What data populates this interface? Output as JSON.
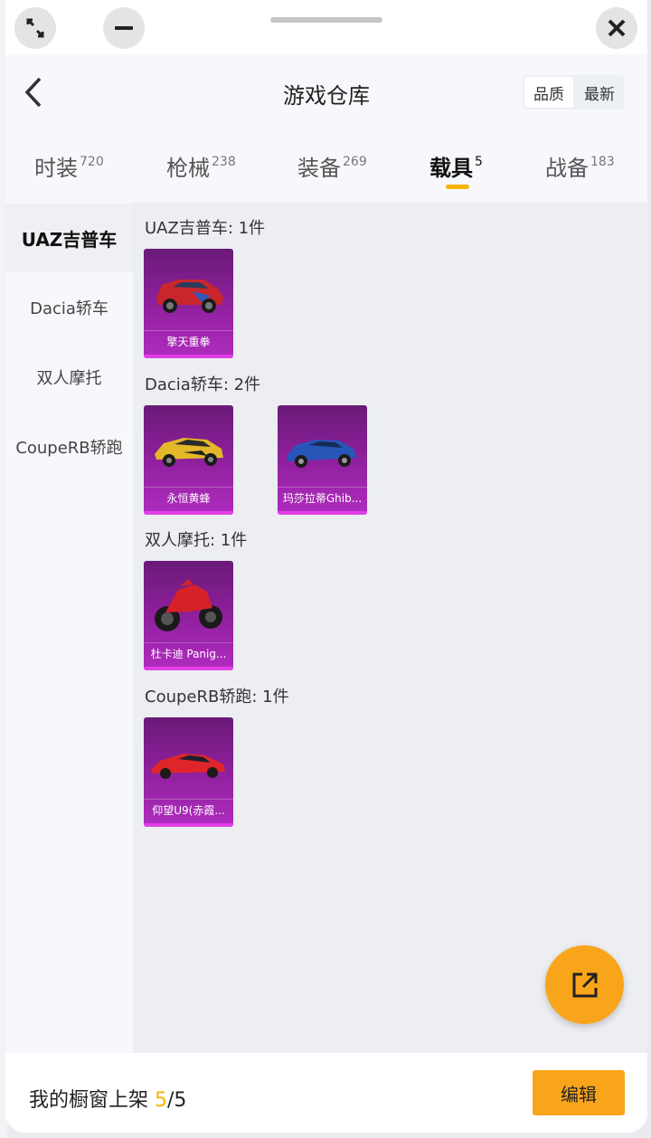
{
  "header": {
    "title": "游戏仓库",
    "sort_options": [
      "品质",
      "最新"
    ],
    "sort_active": "品质"
  },
  "tabs": [
    {
      "label": "时装",
      "count": "720"
    },
    {
      "label": "枪械",
      "count": "238"
    },
    {
      "label": "装备",
      "count": "269"
    },
    {
      "label": "载具",
      "count": "5",
      "active": true
    },
    {
      "label": "战备",
      "count": "183"
    }
  ],
  "sidebar": {
    "items": [
      "UAZ吉普车",
      "Dacia轿车",
      "双人摩托",
      "CoupeRB轿跑"
    ],
    "active": "UAZ吉普车"
  },
  "sections": [
    {
      "title": "UAZ吉普车: 1件",
      "items": [
        {
          "name": "擎天重拳",
          "icon": "red-suv-icon"
        }
      ]
    },
    {
      "title": "Dacia轿车: 2件",
      "items": [
        {
          "name": "永恒黄蜂",
          "icon": "yellow-car-icon"
        },
        {
          "name": "玛莎拉蒂Ghib...",
          "icon": "blue-sedan-icon"
        }
      ]
    },
    {
      "title": "双人摩托: 1件",
      "items": [
        {
          "name": "杜卡迪 Panig...",
          "icon": "red-motorcycle-icon"
        }
      ]
    },
    {
      "title": "CoupeRB轿跑: 1件",
      "items": [
        {
          "name": "仰望U9(赤霞...",
          "icon": "red-sportscar-icon"
        }
      ]
    }
  ],
  "bottom": {
    "label": "我的橱窗上架",
    "current": "5",
    "total": "/5",
    "edit_label": "编辑"
  },
  "colors": {
    "accent": "#f9a51b",
    "highlight": "#f5b500",
    "card_purple": "#8b1f99"
  }
}
